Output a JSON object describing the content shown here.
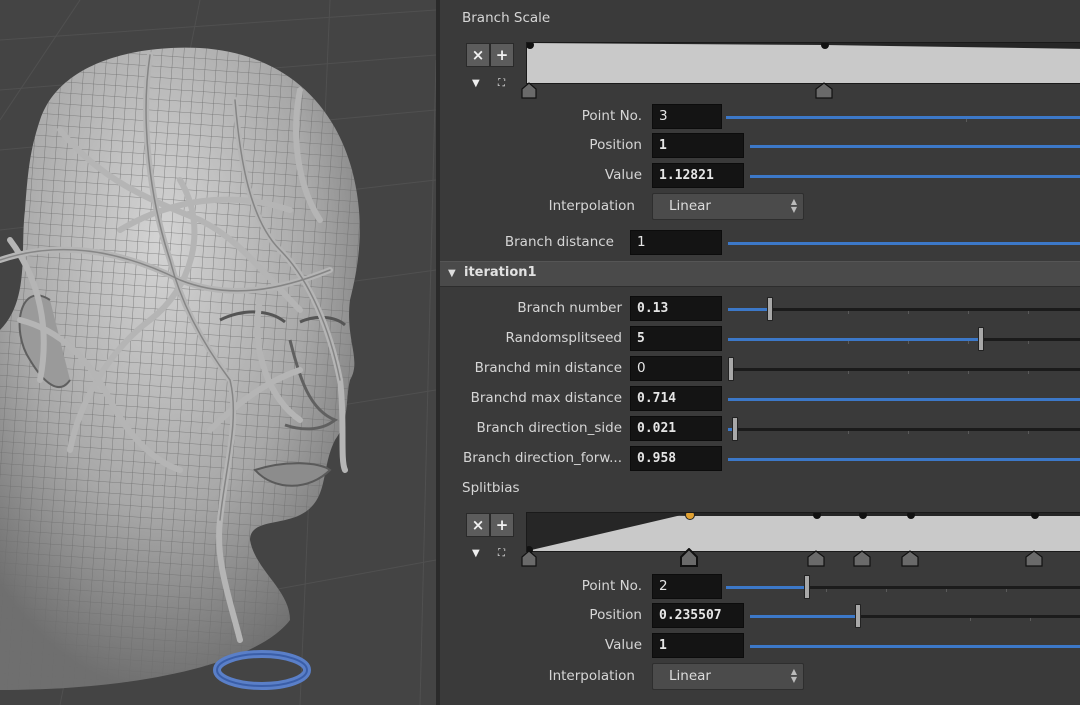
{
  "branch_scale": {
    "title": "Branch Scale",
    "point_no_label": "Point No.",
    "point_no": "3",
    "position_label": "Position",
    "position": "1",
    "value_label": "Value",
    "value": "1.12821",
    "interp_label": "Interpolation",
    "interp": "Linear"
  },
  "branch_distance": {
    "label": "Branch distance",
    "value": "1"
  },
  "iteration": {
    "name": "iteration1",
    "params": [
      {
        "label": "Branch number",
        "value": "0.13",
        "mono": true,
        "level": 0.12
      },
      {
        "label": "Randomsplitseed",
        "value": "5",
        "mono": true,
        "level": 0.72
      },
      {
        "label": "Branchd min distance",
        "value": "0",
        "mono": false,
        "level": 0.0
      },
      {
        "label": "Branchd max distance",
        "value": "0.714",
        "mono": true,
        "level": 1.0
      },
      {
        "label": "Branch direction_side",
        "value": "0.021",
        "mono": true,
        "level": 0.02
      },
      {
        "label": "Branch direction_forw...",
        "value": "0.958",
        "mono": true,
        "level": 1.0
      }
    ]
  },
  "splitbias": {
    "title": "Splitbias",
    "point_no_label": "Point No.",
    "point_no": "2",
    "position_label": "Position",
    "position": "0.235507",
    "value_label": "Value",
    "value": "1",
    "interp_label": "Interpolation",
    "interp": "Linear"
  },
  "ramp_buttons": {
    "remove": "×",
    "add": "+"
  },
  "colors": {
    "accent": "#3c78c8",
    "selected_point": "#e0a030",
    "field_bg": "#141414"
  }
}
